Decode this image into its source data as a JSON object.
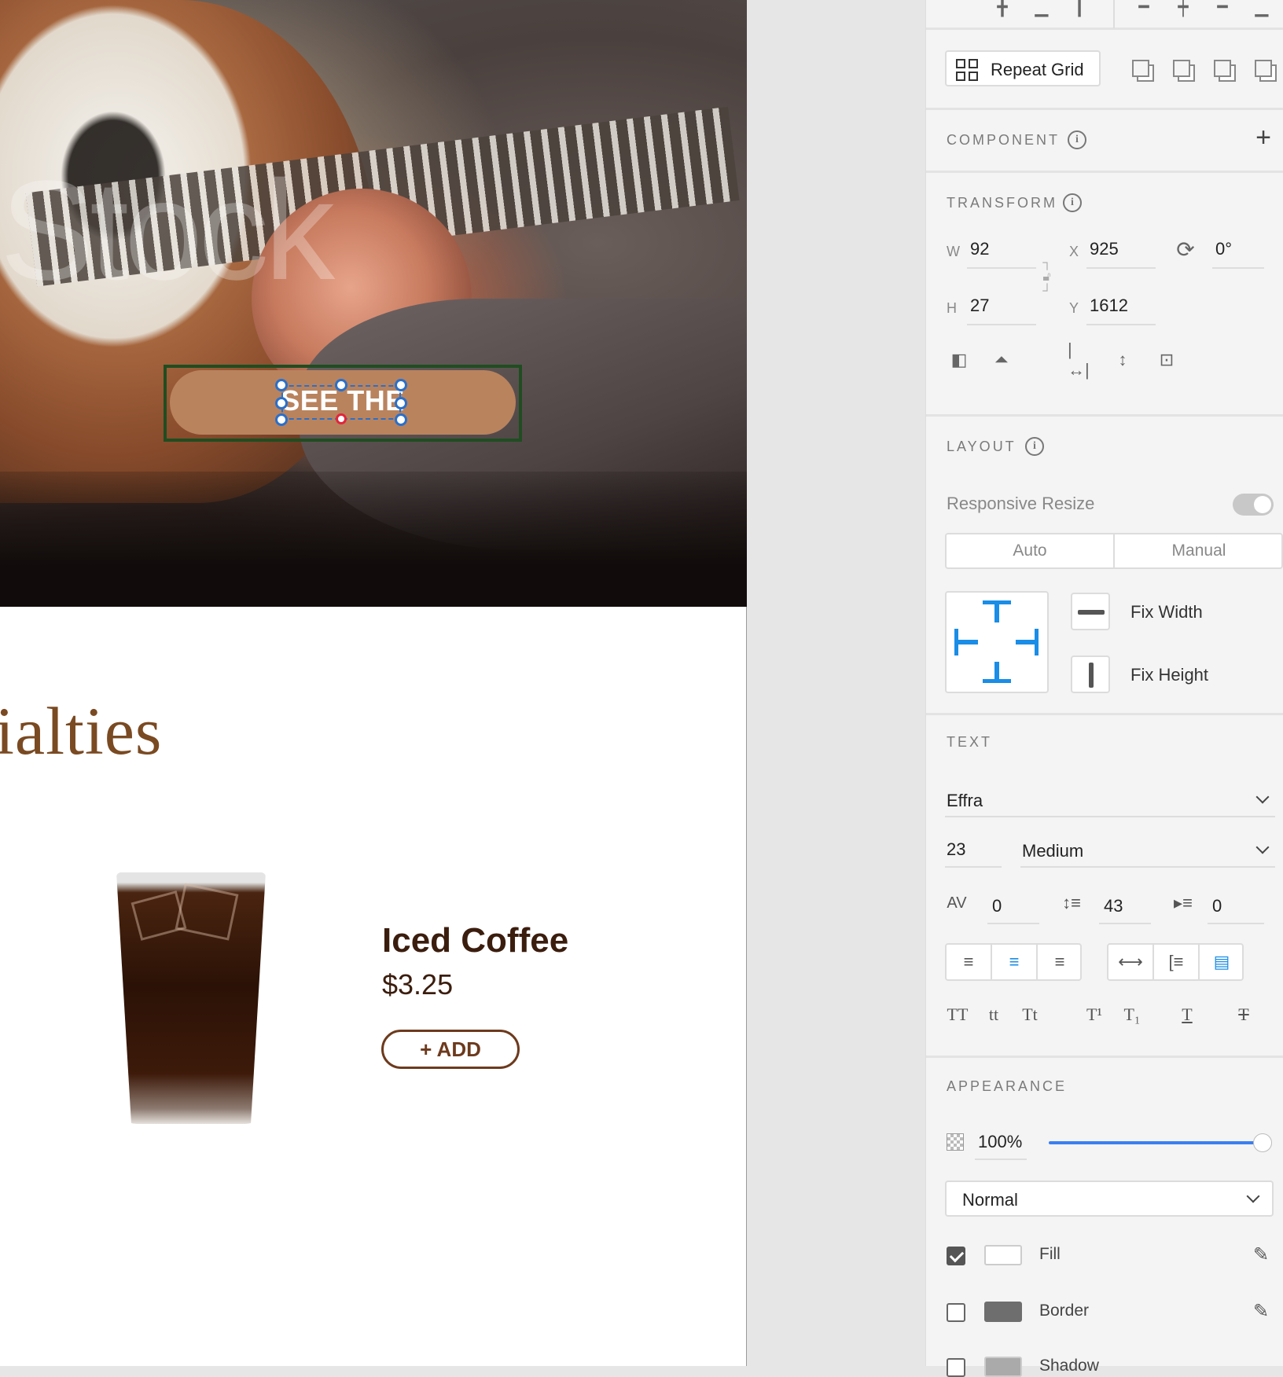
{
  "canvas": {
    "watermark": "Stock",
    "cta": {
      "label": "SEE THE"
    },
    "heading": "ialties",
    "product": {
      "name": "Iced Coffee",
      "price": "$3.25",
      "add_label": "+ ADD"
    }
  },
  "panel": {
    "repeat_grid": {
      "label": "Repeat Grid"
    },
    "component": {
      "title": "COMPONENT",
      "add_icon": "+"
    },
    "transform": {
      "title": "TRANSFORM",
      "w_label": "W",
      "w": "92",
      "h_label": "H",
      "h": "27",
      "x_label": "X",
      "x": "925",
      "y_label": "Y",
      "y": "1612",
      "rotation": "0°"
    },
    "layout": {
      "title": "LAYOUT",
      "responsive_label": "Responsive Resize",
      "tabs": [
        "Auto",
        "Manual"
      ],
      "fix_width": "Fix Width",
      "fix_height": "Fix Height"
    },
    "text": {
      "title": "TEXT",
      "font_family": "Effra",
      "font_size": "23",
      "font_weight": "Medium",
      "char_spacing": "0",
      "line_spacing": "43",
      "paragraph_spacing": "0",
      "case_options": [
        "TT",
        "tt",
        "Tt",
        "T¹",
        "T₁",
        "T",
        "T"
      ]
    },
    "appearance": {
      "title": "APPEARANCE",
      "opacity": "100%",
      "blend_mode": "Normal",
      "fill_label": "Fill",
      "fill_checked": true,
      "fill_color": "#ffffff",
      "border_label": "Border",
      "border_checked": false,
      "border_color": "#6e6e6e",
      "shadow_label": "Shadow"
    },
    "colors": {
      "accent": "#1a8de6",
      "slider": "#3a7ff0",
      "cta_fill": "#b9835e",
      "brand_brown": "#7a4a22"
    }
  }
}
